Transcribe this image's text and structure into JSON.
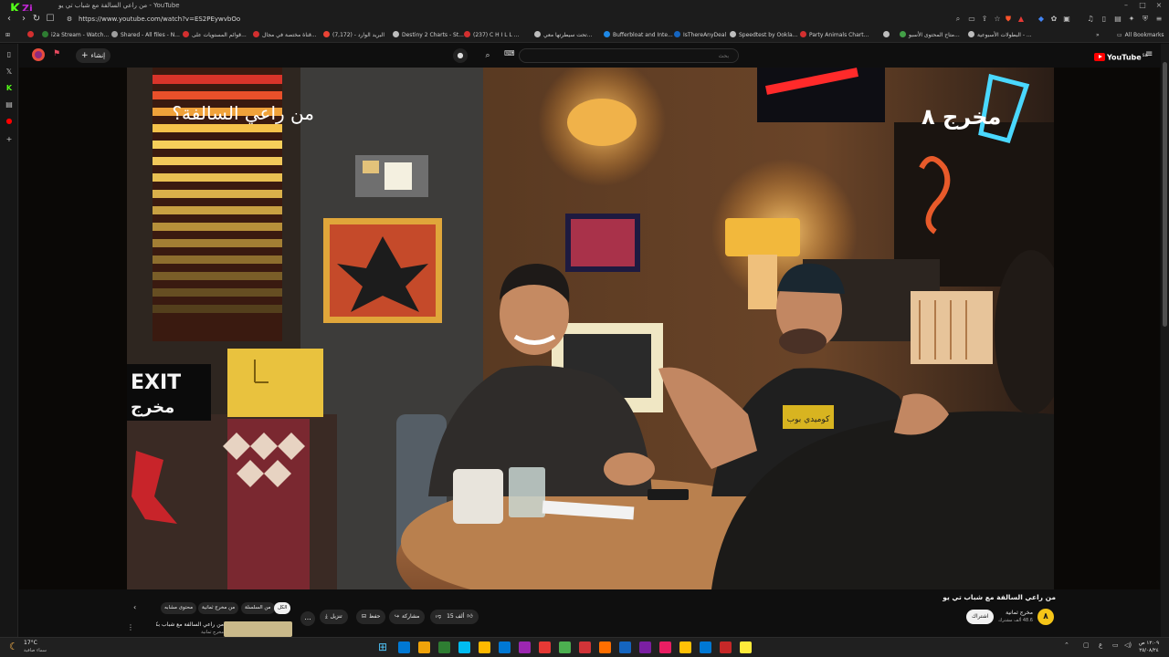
{
  "window": {
    "title": "من راعي السالفة مع شباب تي يو - YouTube",
    "tab_count": "1698"
  },
  "address_bar": {
    "url": "https://www.youtube.com/watch?v=ES2PEywvbOo"
  },
  "bookmarks": {
    "items": [
      {
        "label": "i2a Stream - Watch...",
        "color": "#2e7d32"
      },
      {
        "label": "Shared - All files - N...",
        "color": "#9e9e9e"
      },
      {
        "label": "قوائم المستويات على...",
        "color": "#d32f2f"
      },
      {
        "label": "قناة مختصة في مجال...",
        "color": "#d32f2f"
      },
      {
        "label": "البريد الوارد - (7,172)",
        "color": "#ea4335"
      },
      {
        "label": "Destiny 2 Charts - St...",
        "color": "#bdbdbd"
      },
      {
        "label": "(237) C H I L L ...",
        "color": "#d32f2f"
      },
      {
        "label": "تحت سيطرتها معي...",
        "color": "#bdbdbd"
      },
      {
        "label": "Bufferbloat and Inte...",
        "color": "#1e88e5"
      },
      {
        "label": "IsThereAnyDeal",
        "color": "#1565c0"
      },
      {
        "label": "Speedtest by Ookla...",
        "color": "#bdbdbd"
      },
      {
        "label": "Party Animals Chart...",
        "color": "#d32f2f"
      },
      {
        "label": "متاح المحتوى الأسبو...",
        "color": "#43a047"
      },
      {
        "label": "البطولات الأسبوعية - ...",
        "color": "#bdbdbd"
      }
    ],
    "all_bookmarks": "All Bookmarks"
  },
  "youtube": {
    "create_label": "إنشاء",
    "search_placeholder": "بحث",
    "logo_text": "YouTube",
    "logo_region": "SA"
  },
  "video": {
    "overlay_question": "من راعي السالفة؟",
    "channel_logo_text": "مخرج ٨",
    "exit_sign_top": "EXIT",
    "exit_sign_bottom": "مخرج",
    "mug_text": "كوميدي بوب"
  },
  "video_info": {
    "title": "من راعي السالفة مع شباب تي يو",
    "channel_name": "مخرج ثمانية",
    "subscribers": "48.6 ألف مشترك",
    "join_label": "اشتراك",
    "like_count": "15 ألف",
    "share_label": "مشاركة",
    "save_label": "حفظ",
    "download_label": "تنزيل",
    "more_label": "..."
  },
  "related": {
    "chips": [
      "الكل",
      "من السلسلة",
      "من مخرج ثمانية",
      "محتوى مشابه"
    ],
    "first_video_title": "من راعي السالفة مع شباب بكس",
    "first_video_channel": "مخرج ثمانية"
  },
  "taskbar": {
    "weather_temp": "17°C",
    "weather_desc": "سماء صافية",
    "time": "١٢:٠٩ ص",
    "date": "٢٥/٠٨/٢٤",
    "lang": "ع",
    "app_colors": [
      "#0078d4",
      "#f0a30a",
      "#2e7d32",
      "#00bcf2",
      "#ffb900",
      "#0078d4",
      "#9c27b0",
      "#e53935",
      "#4caf50",
      "#d13438",
      "#ff6f00",
      "#1565c0",
      "#7b1fa2",
      "#e91e63",
      "#ffc107",
      "#0078d4",
      "#c62828",
      "#ffeb3b"
    ]
  }
}
